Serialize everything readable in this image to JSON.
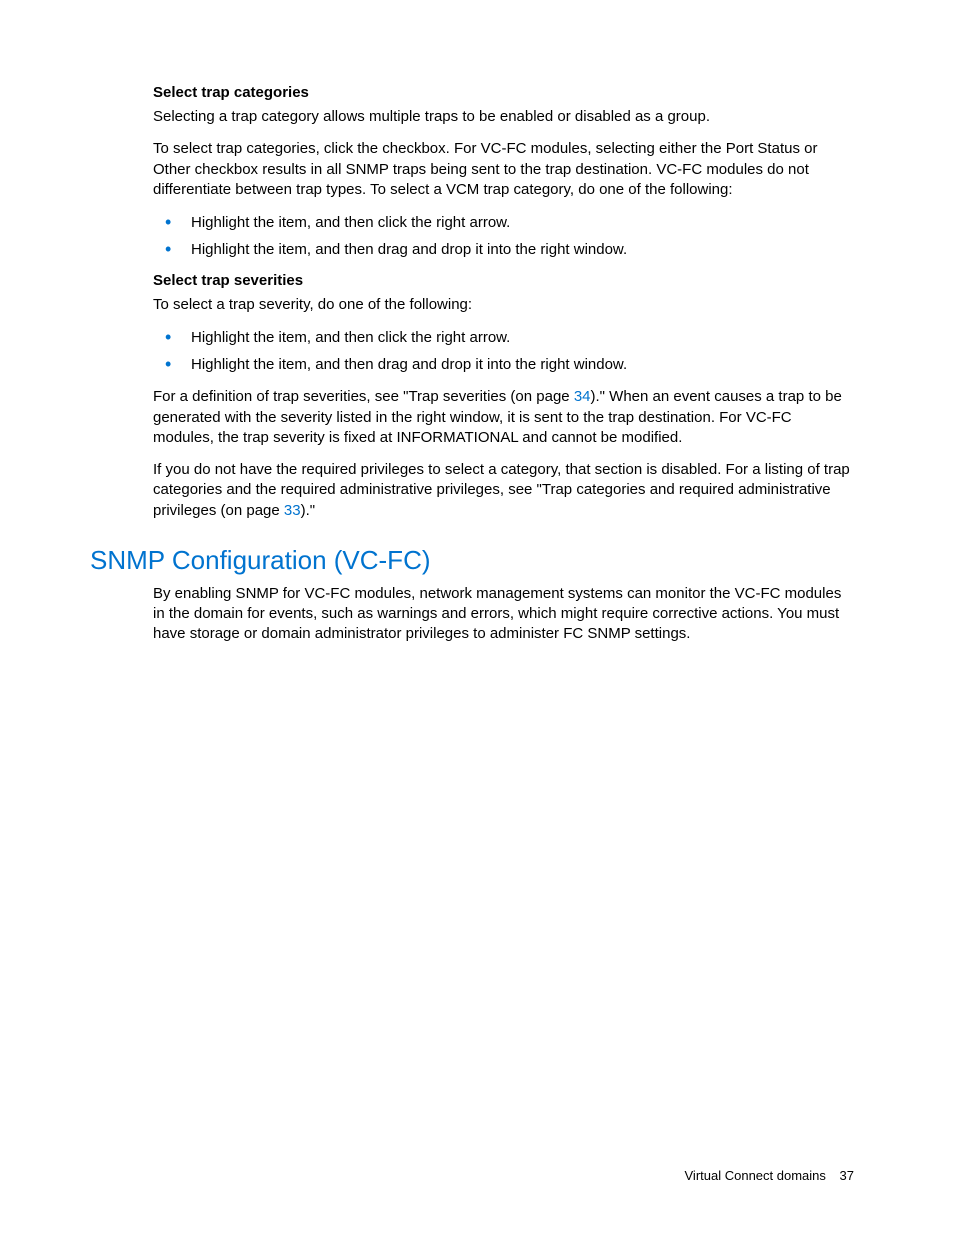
{
  "section1": {
    "heading": "Select trap categories",
    "p1": "Selecting a trap category allows multiple traps to be enabled or disabled as a group.",
    "p2": "To select trap categories, click the checkbox. For VC-FC modules, selecting either the Port Status or Other checkbox results in all SNMP traps being sent to the trap destination. VC-FC modules do not differentiate between trap types. To select a VCM trap category, do one of the following:",
    "bullets": [
      "Highlight the item, and then click the right arrow.",
      "Highlight the item, and then drag and drop it into the right window."
    ]
  },
  "section2": {
    "heading": "Select trap severities",
    "p1": "To select a trap severity, do one of the following:",
    "bullets": [
      "Highlight the item, and then click the right arrow.",
      "Highlight the item, and then drag and drop it into the right window."
    ],
    "p2_pre": "For a definition of trap severities, see \"Trap severities (on page ",
    "p2_link": "34",
    "p2_post": ").\" When an event causes a trap to be generated with the severity listed in the right window, it is sent to the trap destination. For VC-FC modules, the trap severity is fixed at INFORMATIONAL and cannot be modified.",
    "p3_pre": "If you do not have the required privileges to select a category, that section is disabled. For a listing of trap categories and the required administrative privileges, see \"Trap categories and required administrative privileges (on page ",
    "p3_link": "33",
    "p3_post": ").\""
  },
  "section3": {
    "heading": "SNMP Configuration (VC-FC)",
    "p1": "By enabling SNMP for VC-FC modules, network management systems can monitor the VC-FC modules in the domain for events, such as warnings and errors, which might require corrective actions. You must have storage or domain administrator privileges to administer FC SNMP settings."
  },
  "footer": {
    "label": "Virtual Connect domains",
    "page": "37"
  }
}
